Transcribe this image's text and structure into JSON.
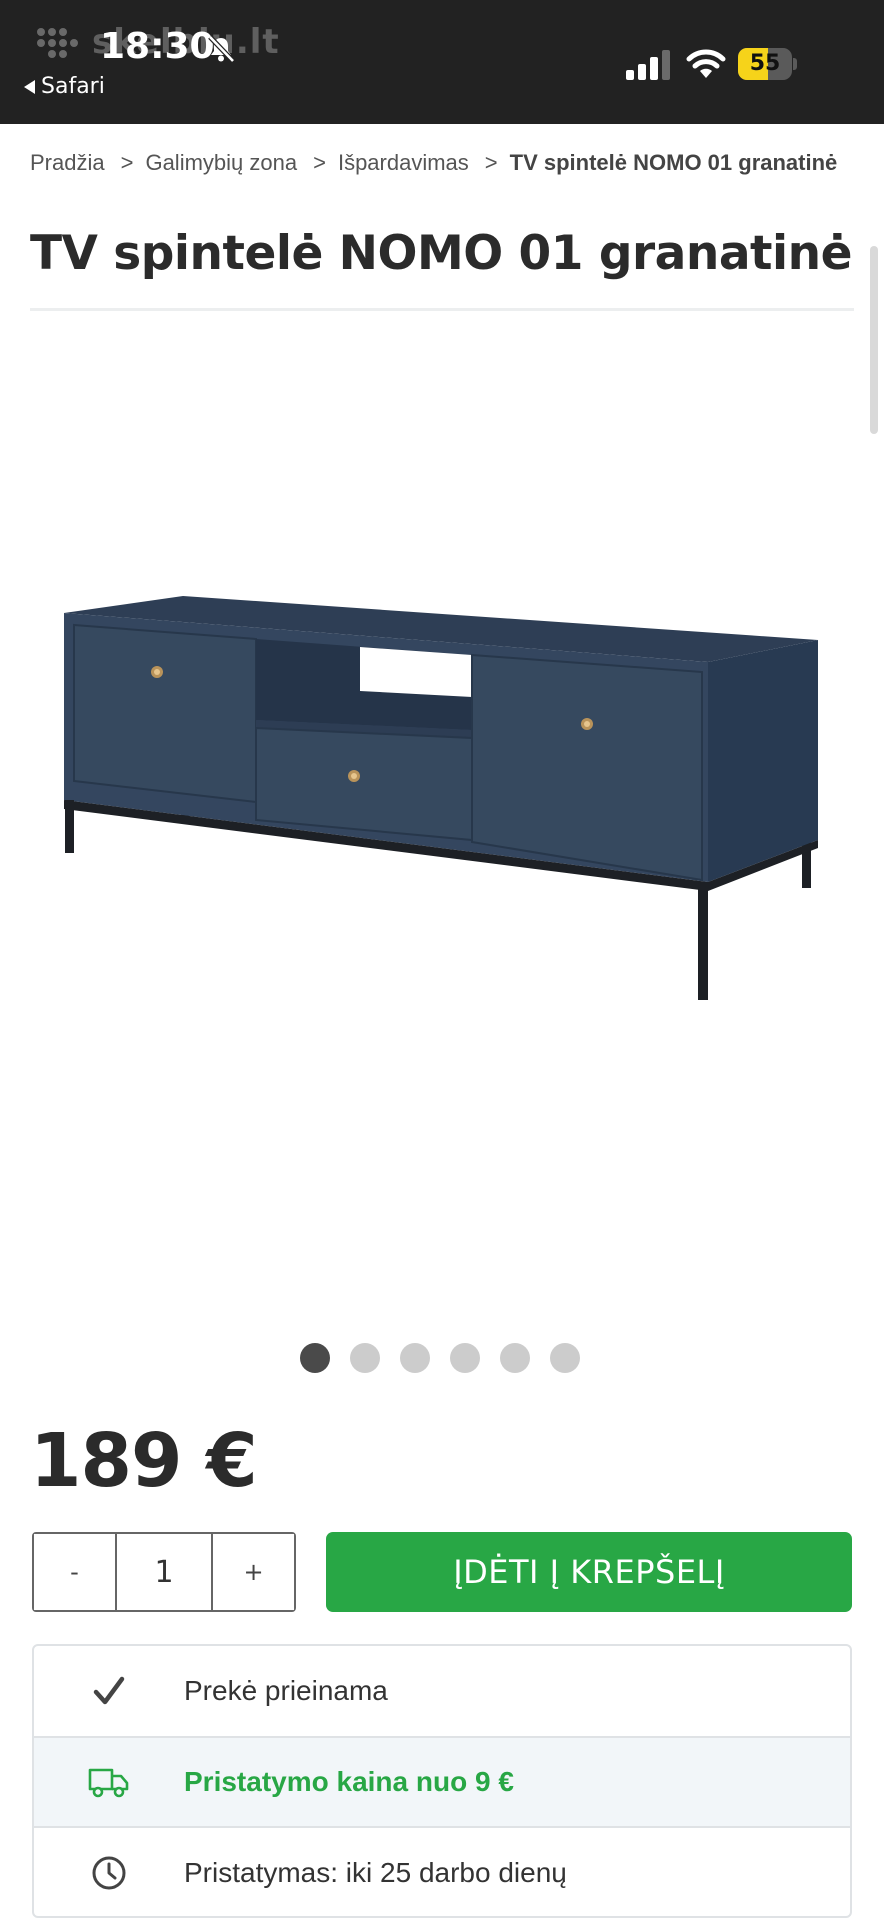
{
  "status_bar": {
    "time": "18:30",
    "back_label": "Safari",
    "ghost_site": "skelbiu.lt",
    "battery_level": "55",
    "battery_fraction": 0.55,
    "signal_icon": "cellular-signal-icon",
    "wifi_icon": "wifi-icon",
    "silent_icon": "bell-slash-icon"
  },
  "breadcrumb": {
    "items": [
      "Pradžia",
      "Galimybių zona",
      "Išpardavimas"
    ],
    "separator": ">",
    "current": "TV spintelė NOMO 01 granatinė"
  },
  "product": {
    "title": "TV spintelė NOMO 01 granatinė",
    "image_count": 6,
    "active_image": 1,
    "price": "189 €",
    "quantity": {
      "minus_label": "-",
      "value": "1",
      "plus_label": "+"
    },
    "add_to_cart_label": "ĮDĖTI Į KREPŠELĮ",
    "info": [
      {
        "icon": "checkmark-icon",
        "text": "Prekė prieinama"
      },
      {
        "icon": "delivery-truck-icon",
        "text": "Pristatymo kaina nuo 9 €"
      },
      {
        "icon": "clock-icon",
        "text": "Pristatymas: iki 25 darbo dienų"
      }
    ]
  },
  "colors": {
    "status_bar_bg": "#222222",
    "accent_green": "#28a745",
    "battery_yellow": "#f6d31a",
    "cabinet_navy": "#34465f"
  }
}
